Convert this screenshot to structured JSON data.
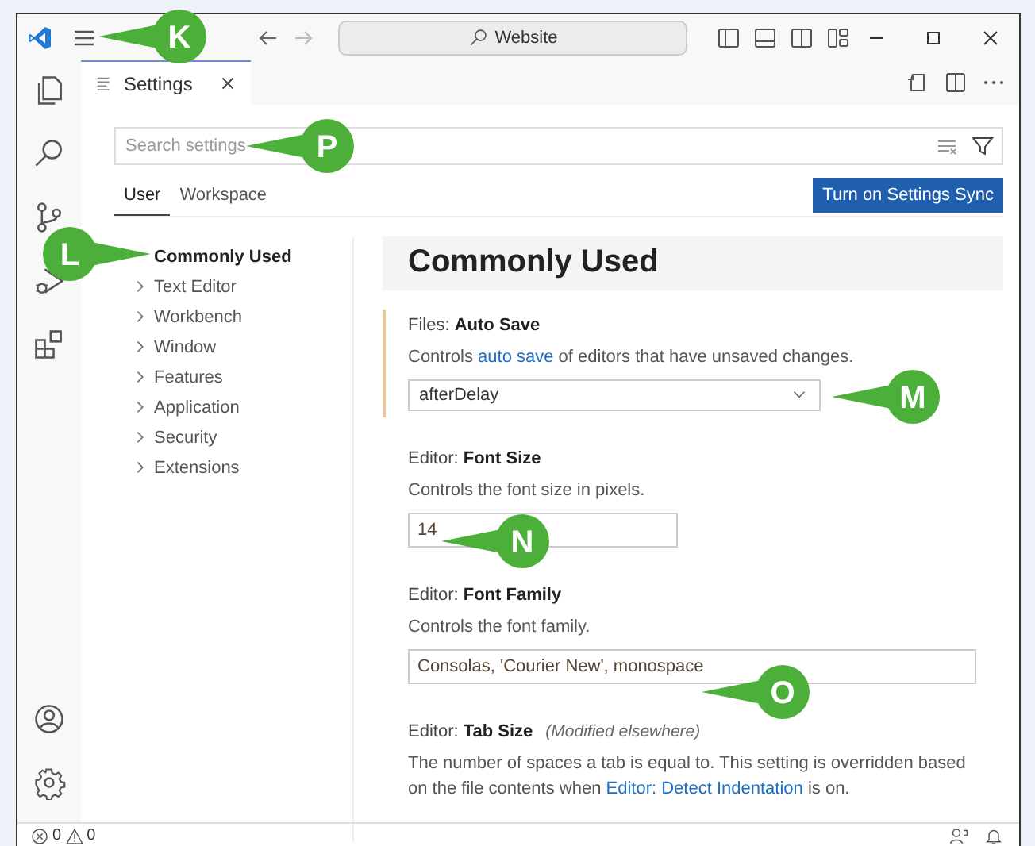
{
  "title_bar": {
    "command_center": "Website"
  },
  "editor_tab": {
    "label": "Settings"
  },
  "search": {
    "placeholder": "Search settings"
  },
  "scope_tabs": [
    {
      "label": "User",
      "selected": true
    },
    {
      "label": "Workspace",
      "selected": false
    }
  ],
  "sync_button": "Turn on Settings Sync",
  "toc": [
    {
      "label": "Commonly Used",
      "selected": true,
      "expandable": false
    },
    {
      "label": "Text Editor",
      "selected": false,
      "expandable": true
    },
    {
      "label": "Workbench",
      "selected": false,
      "expandable": true
    },
    {
      "label": "Window",
      "selected": false,
      "expandable": true
    },
    {
      "label": "Features",
      "selected": false,
      "expandable": true
    },
    {
      "label": "Application",
      "selected": false,
      "expandable": true
    },
    {
      "label": "Security",
      "selected": false,
      "expandable": true
    },
    {
      "label": "Extensions",
      "selected": false,
      "expandable": true
    }
  ],
  "section_heading": "Commonly Used",
  "settings": [
    {
      "kind": "dropdown",
      "category": "Files:",
      "name": "Auto Save",
      "focused": true,
      "description": "Controls ",
      "link": "auto save",
      "description_end": " of editors that have unsaved changes.",
      "value": "afterDelay"
    },
    {
      "kind": "number",
      "category": "Editor:",
      "name": "Font Size",
      "focused": false,
      "description": "Controls the font size in pixels.",
      "value": "14"
    },
    {
      "kind": "text",
      "category": "Editor:",
      "name": "Font Family",
      "focused": false,
      "description": "Controls the font family.",
      "value": "Consolas, 'Courier New', monospace"
    },
    {
      "kind": "none",
      "category": "Editor:",
      "name": "Tab Size",
      "note": "(Modified elsewhere)",
      "focused": false,
      "description": "The number of spaces a tab is equal to. This setting is overridden based on the file contents when ",
      "link": "Editor: Detect Indentation",
      "description_end": " is on."
    }
  ],
  "status_bar": {
    "errors": "0",
    "warnings": "0"
  },
  "callouts": [
    {
      "letter": "K"
    },
    {
      "letter": "P"
    },
    {
      "letter": "L"
    },
    {
      "letter": "M"
    },
    {
      "letter": "N"
    },
    {
      "letter": "O"
    }
  ]
}
